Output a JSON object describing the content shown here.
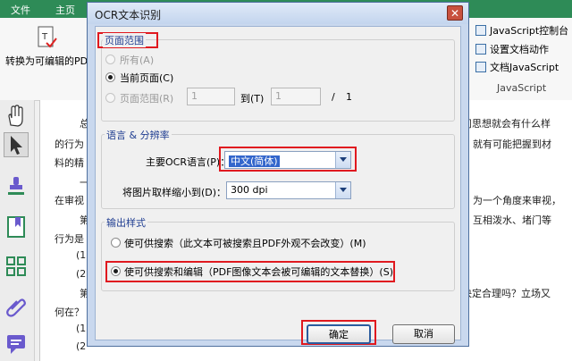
{
  "app": {
    "menu": [
      "文件",
      "主页"
    ],
    "convert_label": "转换为可编辑的PD",
    "ribbon_right": {
      "items": [
        "JavaScript控制台",
        "设置文档动作",
        "文档JavaScript"
      ],
      "group_label": "JavaScript"
    }
  },
  "document": {
    "lines": [
      "总",
      "的行为",
      "料的精",
      "一",
      "在审视",
      "第",
      "行为是",
      "(1",
      "(2",
      "第",
      "何在？",
      "(1",
      "(2"
    ],
    "right_lines": [
      "问思想就会有什么样",
      "就有可能把握到材",
      "为一个角度来审视，",
      "互相泼水、堵门等",
      "决定合理吗？立场又"
    ]
  },
  "dialog": {
    "title": "OCR文本识别",
    "close_glyph": "✕",
    "page_range": {
      "legend": "页面范围",
      "all_label": "所有(A)",
      "current_label": "当前页面(C)",
      "range_label": "页面范围(R)",
      "from_value": "1",
      "to_label": "到(T)",
      "to_value": "1",
      "of_sep": "/",
      "total": "1"
    },
    "language": {
      "legend": "语言 & 分辨率",
      "primary_label": "主要OCR语言(P)：",
      "primary_value": "中文(简体)",
      "downsample_label": "将图片取样缩小到(D)：",
      "downsample_value": "300 dpi"
    },
    "output": {
      "legend": "输出样式",
      "searchable_label": "使可供搜索（此文本可被搜索且PDF外观不会改变）(M)",
      "editable_label": "使可供搜索和编辑（PDF图像文本会被可编辑的文本替换）(S)"
    },
    "ok_label": "确定",
    "cancel_label": "取消"
  },
  "colors": {
    "highlight": "#e0191f",
    "menubar": "#2e8b57",
    "legend_text": "#1f3d91"
  }
}
